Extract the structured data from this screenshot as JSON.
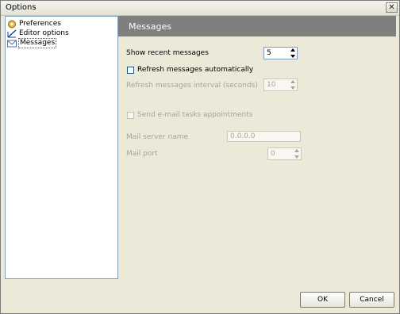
{
  "window": {
    "title": "Options",
    "close_glyph": "✕"
  },
  "tree": {
    "items": [
      {
        "label": "Preferences",
        "icon": "preferences-icon"
      },
      {
        "label": "Editor options",
        "icon": "editor-icon"
      },
      {
        "label": "Messages",
        "icon": "envelope-icon",
        "selected": true
      }
    ]
  },
  "panel": {
    "title": "Messages",
    "show_recent_label": "Show recent messages",
    "show_recent_value": "5",
    "refresh_auto_label": "Refresh messages automatically",
    "refresh_auto_checked": false,
    "refresh_interval_label": "Refresh messages interval (seconds)",
    "refresh_interval_value": "10",
    "send_email_label": "Send e-mail tasks appointments",
    "send_email_checked": false,
    "mail_server_label": "Mail server name",
    "mail_server_value": "0.0.0.0",
    "mail_port_label": "Mail port",
    "mail_port_value": "0"
  },
  "buttons": {
    "ok": "OK",
    "cancel": "Cancel"
  },
  "colors": {
    "header_bg": "#7f7f7f",
    "dialog_bg": "#ece9d8",
    "disabled_text": "#a6a496"
  }
}
